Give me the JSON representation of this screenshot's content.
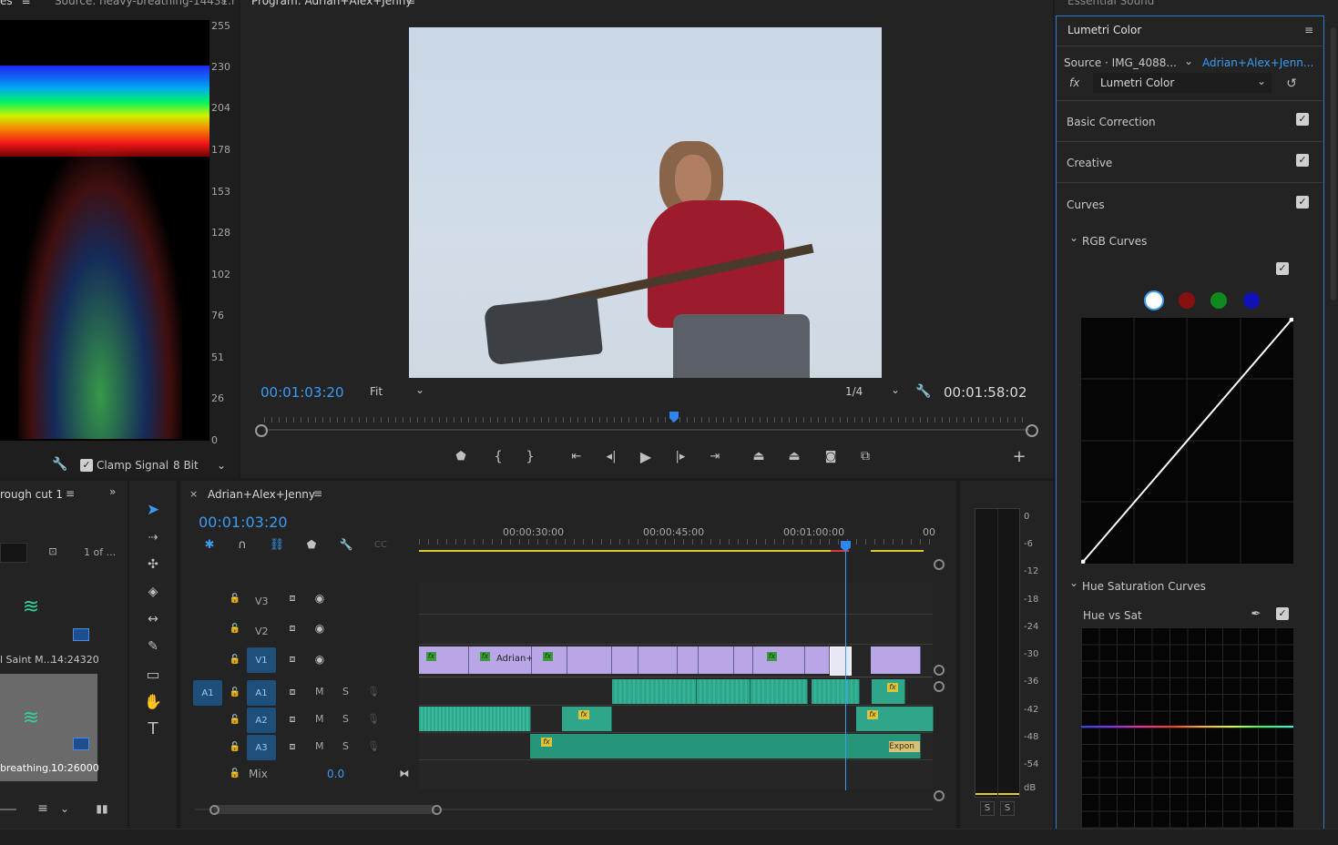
{
  "scope_panel": {
    "tab_partial": "es",
    "source_title": "Source: heavy-breathing-14431.r",
    "scale": [
      "255",
      "230",
      "204",
      "178",
      "153",
      "128",
      "102",
      "76",
      "51",
      "26",
      "0"
    ],
    "clamp_label": "Clamp Signal",
    "bit_depth": "8 Bit"
  },
  "program": {
    "title": "Program: Adrian+Alex+Jenny",
    "timecode": "00:01:03:20",
    "zoom": "Fit",
    "resolution": "1/4",
    "duration": "00:01:58:02",
    "playhead_fraction": 0.54
  },
  "project": {
    "tab_label": "rough cut 1",
    "page_count": "1 of ...",
    "items": [
      {
        "name": "l Saint M...",
        "duration": "14:24320"
      },
      {
        "name": "breathing...",
        "duration": "10:26000"
      }
    ]
  },
  "timeline": {
    "tab_label": "Adrian+Alex+Jenny",
    "timecode": "00:01:03:20",
    "ruler": [
      "00:00:30:00",
      "00:00:45:00",
      "00:01:00:00",
      "00"
    ],
    "tracks_video": [
      "V3",
      "V2",
      "V1"
    ],
    "tracks_audio": [
      "A1",
      "A2",
      "A3"
    ],
    "source_patch": "A1",
    "mix_label": "Mix",
    "mix_value": "0.0",
    "clip_name": "Adrian+",
    "audio_clip_label": "Expon",
    "m_label": "M",
    "s_label": "S"
  },
  "meter": {
    "scale": [
      "0",
      "-6",
      "-12",
      "-18",
      "-24",
      "-30",
      "-36",
      "-42",
      "-48",
      "-54",
      "dB"
    ],
    "solo": [
      "S",
      "S"
    ]
  },
  "lumetri": {
    "header_above": "Essential Sound",
    "title": "Lumetri Color",
    "source": "Source · IMG_4088...",
    "sequence": "Adrian+Alex+Jenn...",
    "effect": "Lumetri Color",
    "sections": [
      "Basic Correction",
      "Creative",
      "Curves"
    ],
    "rgb_curves": "RGB Curves",
    "hue_sat_curves": "Hue Saturation Curves",
    "hue_vs_sat": "Hue vs Sat",
    "channel_colors": [
      "#ffffff",
      "#8a0f0f",
      "#0f8a1e",
      "#1111b8"
    ]
  }
}
